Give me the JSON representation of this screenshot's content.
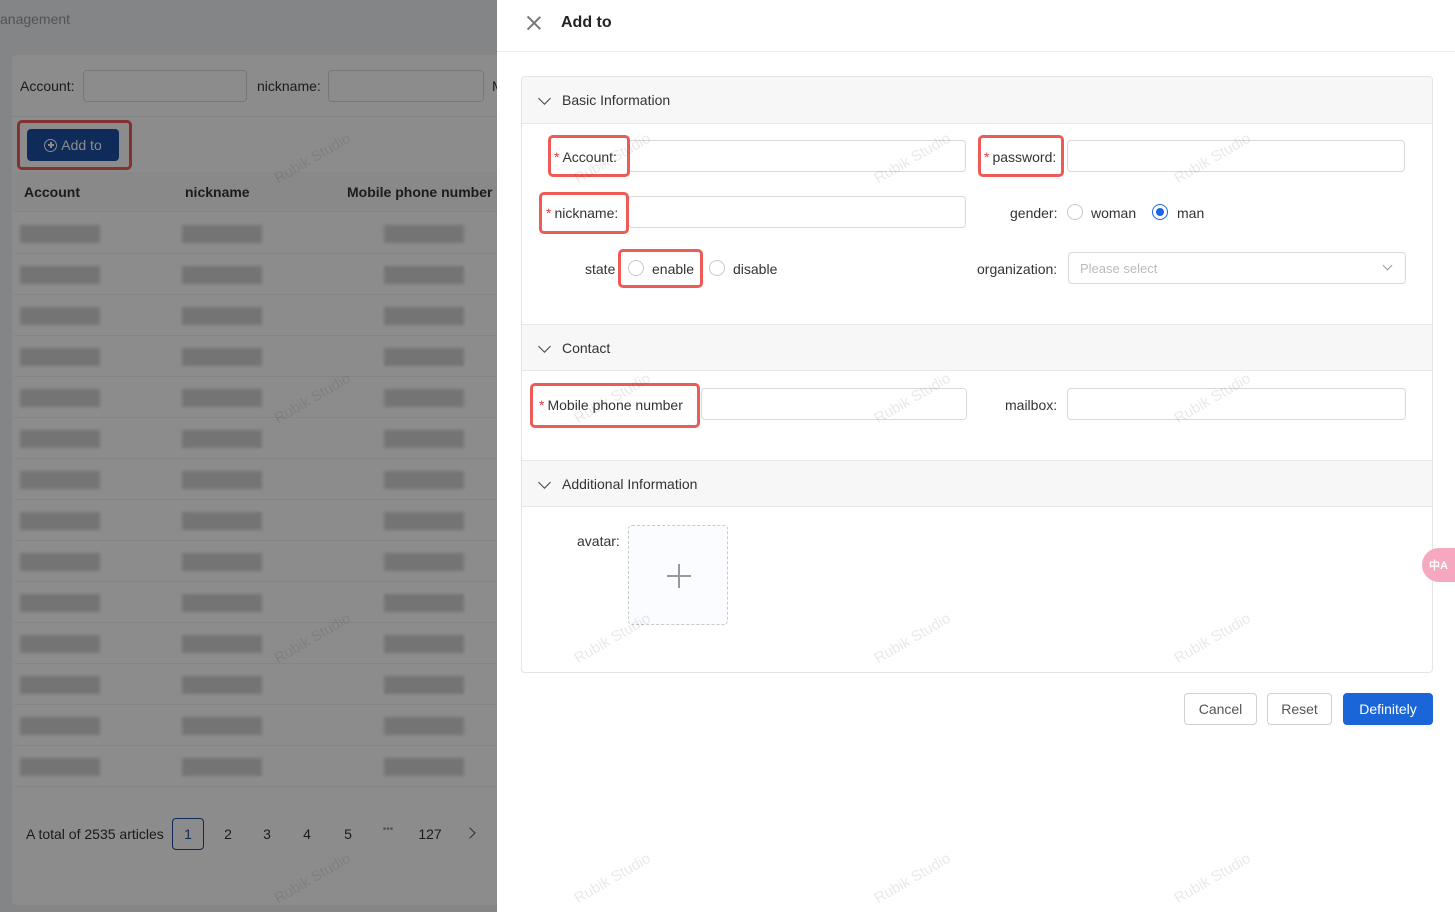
{
  "background": {
    "page_title": "anagement",
    "search_account_label": "Account:",
    "search_nickname_label": "nickname:",
    "search_more_label": "M",
    "add_button_label": "Add to",
    "table_headers": [
      "Account",
      "nickname",
      "Mobile phone number"
    ],
    "total_text": "A total of 2535 articles",
    "pagination": {
      "active": "1",
      "pages": [
        "2",
        "3",
        "4",
        "5"
      ],
      "ellipsis": "•••",
      "last": "127",
      "next_icon": "chevron-right-icon"
    }
  },
  "drawer": {
    "title": "Add to",
    "close_icon": "close-icon",
    "sections": {
      "basic": {
        "title": "Basic Information",
        "account_label": "Account:",
        "password_label": "password:",
        "nickname_label": "nickname:",
        "gender_label": "gender:",
        "gender_options": [
          {
            "label": "woman",
            "checked": false
          },
          {
            "label": "man",
            "checked": true
          }
        ],
        "state_label": "state",
        "state_options": [
          {
            "label": "enable",
            "checked": false
          },
          {
            "label": "disable",
            "checked": false
          }
        ],
        "organization_label": "organization:",
        "organization_placeholder": "Please select"
      },
      "contact": {
        "title": "Contact",
        "mobile_label": "Mobile phone number",
        "mailbox_label": "mailbox:"
      },
      "additional": {
        "title": "Additional Information",
        "avatar_label": "avatar:"
      }
    },
    "buttons": {
      "cancel": "Cancel",
      "reset": "Reset",
      "confirm": "Definitely"
    }
  },
  "watermark": "Rubik Studio",
  "floating_translate_icon": "中A",
  "colors": {
    "primary": "#1a66d9",
    "highlight": "#ee5b56",
    "required": "#e53935"
  }
}
